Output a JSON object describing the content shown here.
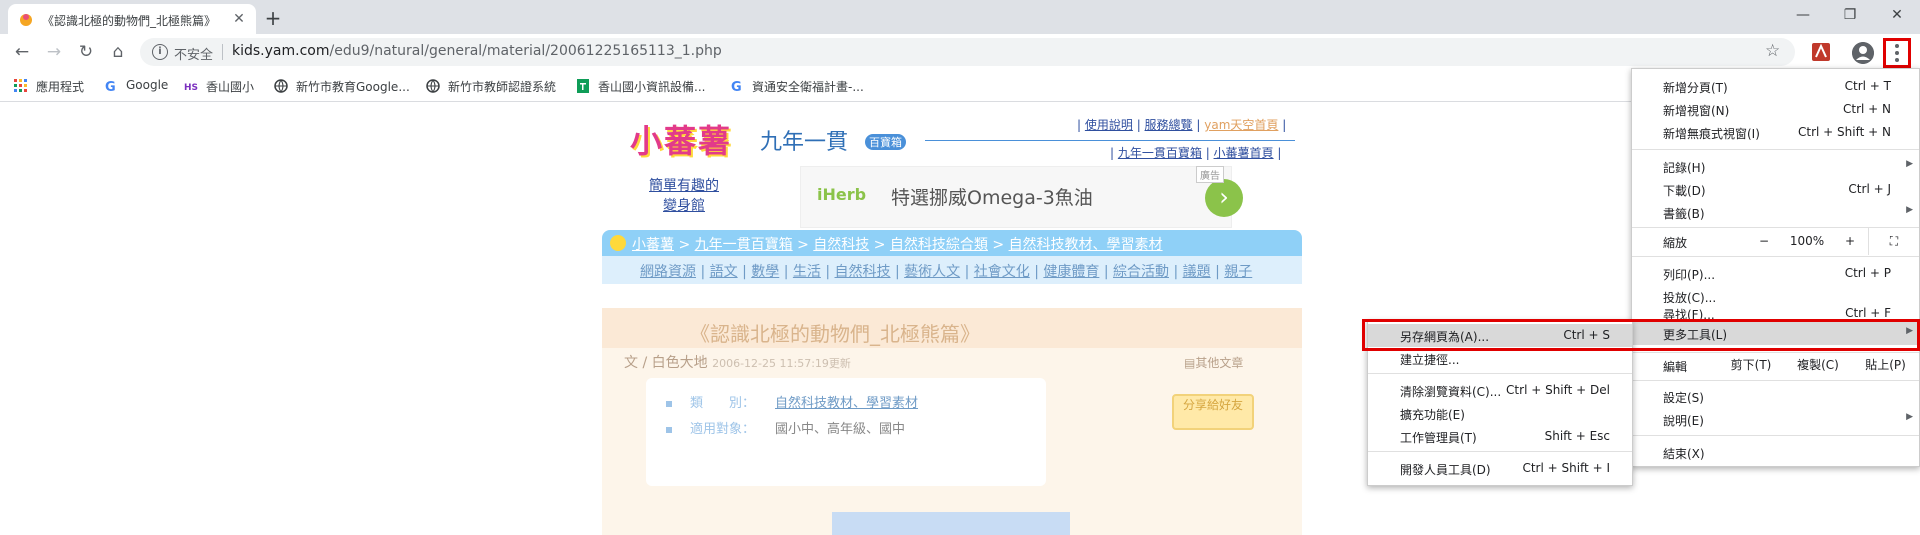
{
  "tab": {
    "title": "《認識北極的動物們_北極熊篇》",
    "close": "✕",
    "new_tab": "+"
  },
  "window_controls": {
    "minimize": "—",
    "restore": "❐",
    "close": "✕"
  },
  "toolbar": {
    "back": "←",
    "forward": "→",
    "reload": "↻",
    "home": "⌂",
    "insecure": "不安全",
    "url_host": "kids.yam.com",
    "url_path": "/edu9/natural/general/material/20061225165113_1.php",
    "star": "☆"
  },
  "bookmarks": [
    {
      "label": "應用程式",
      "icon": "apps-grid-icon",
      "color": "#e8453c"
    },
    {
      "label": "Google",
      "icon": "google-icon",
      "color": "#4285f4"
    },
    {
      "label": "香山國小",
      "icon": "hs-icon",
      "color": "#7b2fbf"
    },
    {
      "label": "新竹市教育Google...",
      "icon": "globe-icon",
      "color": "#3c4043"
    },
    {
      "label": "新竹市教師認證系統",
      "icon": "globe-icon",
      "color": "#3c4043"
    },
    {
      "label": "香山國小資訊設備...",
      "icon": "green-sheet-icon",
      "color": "#0f9d58"
    },
    {
      "label": "資通安全衛福計畫-...",
      "icon": "google-icon",
      "color": "#4285f4"
    }
  ],
  "page": {
    "logo_text": "小蕃薯",
    "logo_sub": "九年一貫",
    "logo_sub2": "百寶箱",
    "top_links_1": [
      "使用說明",
      "服務總覽",
      "yam天空首頁"
    ],
    "top_links_2": [
      "九年一貫百寶箱",
      "小蕃薯首頁"
    ],
    "ad_left": "簡單有趣的變身館",
    "ad_brand": "iHerb",
    "ad_text": "特選挪威Omega-3魚油",
    "ad_tag": "廣告",
    "ad_arrow": "›",
    "breadcrumb": [
      "小蕃薯",
      "九年一貫百寶箱",
      "自然科技",
      "自然科技綜合類",
      "自然科技教材、學習素材"
    ],
    "breadcrumb_sep": " > ",
    "categories": [
      "網路資源",
      "語文",
      "數學",
      "生活",
      "自然科技",
      "藝術人文",
      "社會文化",
      "健康體育",
      "綜合活動",
      "議題",
      "親子"
    ],
    "article_title": "《認識北極的動物們_北極熊篇》",
    "article_author_prefix": "文 / ",
    "article_author": "白色大地",
    "article_date": "2006-12-25 11:57:19更新",
    "other_articles": "其他文章",
    "info": [
      {
        "key": "類　　別：",
        "value": "自然科技教材、學習素材"
      },
      {
        "key": "適用對象：",
        "value": "國小中、高年級、國中"
      }
    ],
    "share": "分享給好友"
  },
  "menu": {
    "items": [
      {
        "label": "新增分頁(T)",
        "key": "Ctrl + T"
      },
      {
        "label": "新增視窗(N)",
        "key": "Ctrl + N"
      },
      {
        "label": "新增無痕式視窗(I)",
        "key": "Ctrl + Shift + N"
      },
      {
        "label": "記錄(H)",
        "arrow": "▶"
      },
      {
        "label": "下載(D)",
        "key": "Ctrl + J"
      },
      {
        "label": "書籤(B)",
        "arrow": "▶"
      },
      {
        "label": "列印(P)...",
        "key": "Ctrl + P"
      },
      {
        "label": "投放(C)..."
      },
      {
        "label": "尋找(F)...",
        "key": "Ctrl + F"
      },
      {
        "label": "更多工具(L)",
        "arrow": "▶"
      },
      {
        "label": "設定(S)"
      },
      {
        "label": "說明(E)",
        "arrow": "▶"
      },
      {
        "label": "結束(X)"
      }
    ],
    "zoom_label": "縮放",
    "zoom_minus": "−",
    "zoom_value": "100%",
    "zoom_plus": "+",
    "fullscreen": "⛶",
    "edit_label": "編輯",
    "cut": "剪下(T)",
    "copy": "複製(C)",
    "paste": "貼上(P)"
  },
  "submenu": {
    "items": [
      {
        "label": "另存網頁為(A)...",
        "key": "Ctrl + S"
      },
      {
        "label": "建立捷徑..."
      },
      {
        "label": "清除瀏覽資料(C)...",
        "key": "Ctrl + Shift + Del"
      },
      {
        "label": "擴充功能(E)"
      },
      {
        "label": "工作管理員(T)",
        "key": "Shift + Esc"
      },
      {
        "label": "開發人員工具(D)",
        "key": "Ctrl + Shift + I"
      }
    ]
  },
  "colors": {
    "highlight_red": "#e00000",
    "menu_hover": "#d9d9d9"
  }
}
